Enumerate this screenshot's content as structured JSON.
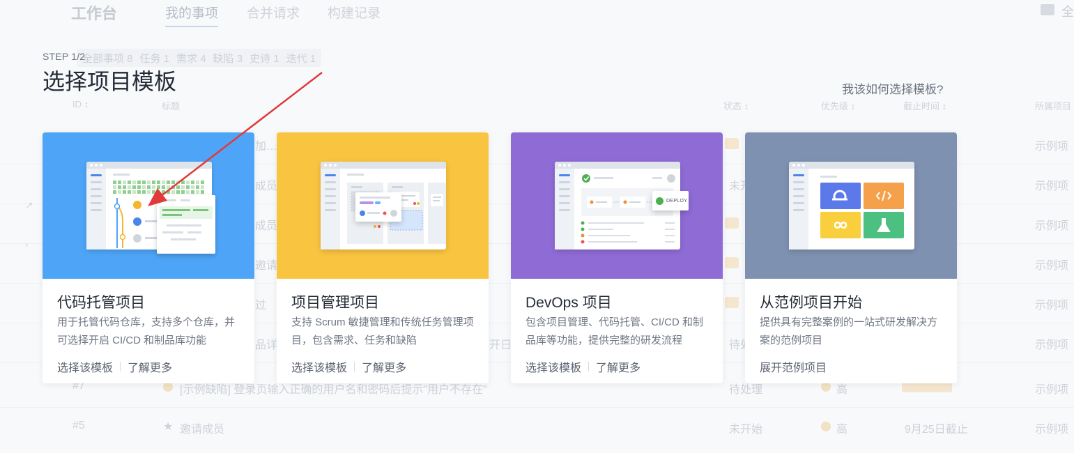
{
  "background": {
    "app_title": "工作台",
    "tabs": [
      {
        "label": "我的事项",
        "active": true
      },
      {
        "label": "合并请求",
        "active": false
      },
      {
        "label": "构建记录",
        "active": false
      }
    ],
    "top_right_label": "全",
    "filters": [
      "全部事项 8",
      "任务 1",
      "需求 4",
      "缺陷 3",
      "史诗 1",
      "迭代 1"
    ],
    "columns": [
      "ID ↕",
      "标题",
      "状态 ↕",
      "优先级 ↕",
      "截止时间 ↕",
      "所属项目"
    ],
    "rows": [
      {
        "title": "加…",
        "project": "示例项"
      },
      {
        "title": "成员",
        "status": "未开",
        "project": "示例项"
      },
      {
        "title": "成员",
        "project": "示例项"
      },
      {
        "title": "邀请",
        "project": "示例项"
      },
      {
        "title": "过",
        "project": "示例项"
      },
      {
        "title": "品详",
        "extra": "开日",
        "status": "待处",
        "project": "示例项"
      },
      {
        "id": "#7",
        "title": "[示例缺陷] 登录页输入正确的用户名和密码后提示\"用户不存在\"",
        "status": "待处理",
        "priority": "高",
        "project": "示例项"
      },
      {
        "id": "#5",
        "title": "邀请成员",
        "status": "未开始",
        "priority": "高",
        "due": "9月25日截止",
        "project": "示例项"
      }
    ]
  },
  "step_label": "STEP 1/2",
  "page_title": "选择项目模板",
  "help_link": "我该如何选择模板?",
  "cards": [
    {
      "title": "代码托管项目",
      "description": "用于托管代码仓库，支持多个仓库，并可选择开启 CI/CD 和制品库功能",
      "action_primary": "选择该模板",
      "action_secondary": "了解更多",
      "color": "#4ea5f8"
    },
    {
      "title": "项目管理项目",
      "description": "支持 Scrum 敏捷管理和传统任务管理项目，包含需求、任务和缺陷",
      "action_primary": "选择该模板",
      "action_secondary": "了解更多",
      "color": "#f9c440"
    },
    {
      "title": "DevOps 项目",
      "description": "包含项目管理、代码托管、CI/CD 和制品库等功能，提供完整的研发流程",
      "action_primary": "选择该模板",
      "action_secondary": "了解更多",
      "color": "#8f6bd6",
      "badge": "DEPLOY"
    },
    {
      "title": "从范例项目开始",
      "description": "提供具有完整案例的一站式研发解决方案的范例项目",
      "action_primary": "展开范例项目",
      "color": "#7e91b0"
    }
  ],
  "annotation": {
    "type": "red-arrow",
    "color": "#e03a3a",
    "points_to": "代码托管项目"
  }
}
